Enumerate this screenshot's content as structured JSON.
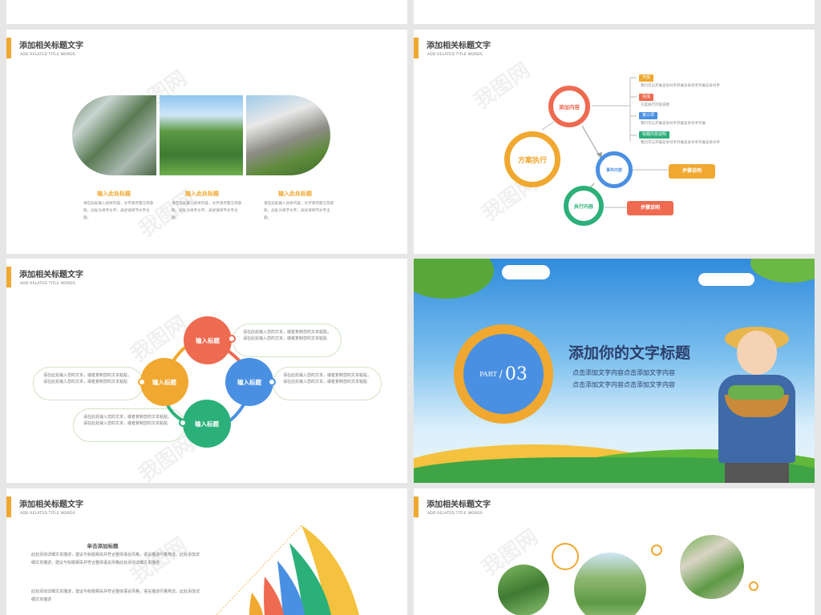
{
  "header": {
    "title": "添加相关标题文字",
    "subtitle": "ADD RELATED TITLE WORDS"
  },
  "watermark": "我图网",
  "slide1": {
    "columns": [
      {
        "title": "输入此处标题",
        "body": "请在此处输入具体内容，文字请尽量言简意赅，此处为单字文字，表述请将节文字主题。"
      },
      {
        "title": "输入此处标题",
        "body": "请在此处输入具体内容，文字请尽量言简意赅，此处为单字文字，表述请将节文字主题。"
      },
      {
        "title": "输入此处标题",
        "body": "请在此处输入具体内容，文字请尽量言简意赅，此处为单字文字，表述请将节文字主题。"
      }
    ]
  },
  "slide2": {
    "big_circle": "方案执行",
    "circle_top": "添加内容",
    "circle_mid": "事件内容",
    "circle_bot": "执行内容",
    "tags": [
      {
        "label": "开放",
        "text": "我们可以开展竞争对手开展竞争对手开展竞争对手",
        "color": "#f0a830"
      },
      {
        "label": "完成",
        "text": "方案执行内容说明",
        "color": "#ee6a50"
      },
      {
        "label": "第三项",
        "text": "我们可以开展竞争对手开展竞争对手开展",
        "color": "#4a90e2"
      },
      {
        "label": "标题内容说明",
        "text": "我们可以开展竞争对手开展竞争对手开展竞争对手",
        "color": "#2cb07a"
      }
    ],
    "pill1": "步骤说明",
    "pill2": "步骤说明",
    "colors": {
      "orange": "#f0a830",
      "red": "#ee6a50",
      "blue": "#4a90e2",
      "green": "#2cb07a"
    }
  },
  "slide3": {
    "bubble_label": "输入标题",
    "box_text": "请在此处输入您的文本，或者复制您的文本粘贴，请在此处输入您的文本，或者复制您的文本粘贴"
  },
  "slide4": {
    "part_label": "PART",
    "part_number": "03",
    "title": "添加你的文字标题",
    "lines": [
      "点击添加文字内容点击添加文字内容",
      "点击添加文字内容点击添加文字内容"
    ]
  },
  "slide5": {
    "heading": "单击添加标题",
    "para1": "此处添加详细文本描述，建议与标题相关并符合整体语言风格，语言描述尽量简洁，此处添加详细文本描述，建议与标题相关并符合整体语言风格此处添加详细文本描述",
    "para2": "此处添加详细文本描述，建议与标题相关并符合整体语言风格，语言描述尽量简洁，此处添加详细文本描述"
  }
}
